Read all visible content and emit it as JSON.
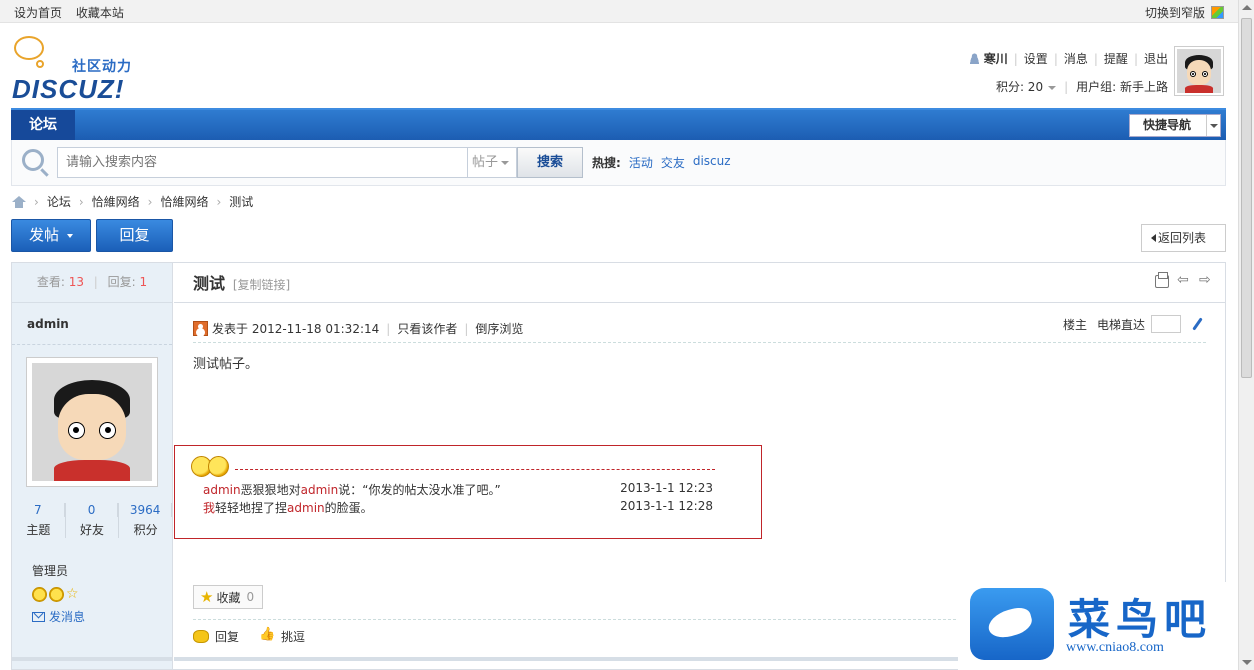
{
  "topbar": {
    "set_home": "设为首页",
    "bookmark": "收藏本站",
    "switch_style": "切换到窄版"
  },
  "logo": {
    "sub": "社区动力",
    "main": "DISCUZ!"
  },
  "user": {
    "name": "寒川",
    "settings": "设置",
    "messages": "消息",
    "reminders": "提醒",
    "logout": "退出",
    "points_label": "积分: 20",
    "group_label": "用户组: 新手上路"
  },
  "nav": {
    "forum_tab": "论坛",
    "quick_nav": "快捷导航"
  },
  "search": {
    "placeholder": "请输入搜索内容",
    "type": "帖子",
    "button": "搜索",
    "hot_label": "热搜:",
    "hot": [
      "活动",
      "交友",
      "discuz"
    ]
  },
  "breadcrumb": [
    "论坛",
    "恰維网络",
    "恰維网络",
    "测试"
  ],
  "actions": {
    "post": "发帖",
    "reply": "回复",
    "back": "返回列表"
  },
  "sidebar": {
    "views_label": "查看:",
    "views": "13",
    "replies_label": "回复:",
    "replies": "1",
    "author": "admin",
    "counts": [
      {
        "n": "7",
        "t": "主题"
      },
      {
        "n": "0",
        "t": "好友"
      },
      {
        "n": "3964",
        "t": "积分"
      }
    ],
    "group": "管理员",
    "pm": "发消息"
  },
  "thread": {
    "title": "测试",
    "copy_link": "[复制链接]",
    "posted_label": "发表于 2012-11-18 01:32:14",
    "only_author": "只看该作者",
    "reverse": "倒序浏览",
    "floor": "楼主",
    "jump_label": "电梯直达",
    "body": "测试帖子。"
  },
  "rates": [
    {
      "actor": "admin",
      "mid1": "恶狠狠地对",
      "target": "admin",
      "mid2": "说：“你发的帖太没水准了吧。”",
      "time": "2013-1-1 12:23"
    },
    {
      "actor": "我",
      "mid1": "轻轻地捏了捏",
      "target": "admin",
      "mid2": "的脸蛋。",
      "time": "2013-1-1 12:28"
    }
  ],
  "post_actions": {
    "favorite": "收藏",
    "fav_count": "0",
    "reply": "回复",
    "tease": "挑逗"
  },
  "watermark": {
    "cn": "菜鸟吧",
    "url": "www.cniao8.com"
  }
}
